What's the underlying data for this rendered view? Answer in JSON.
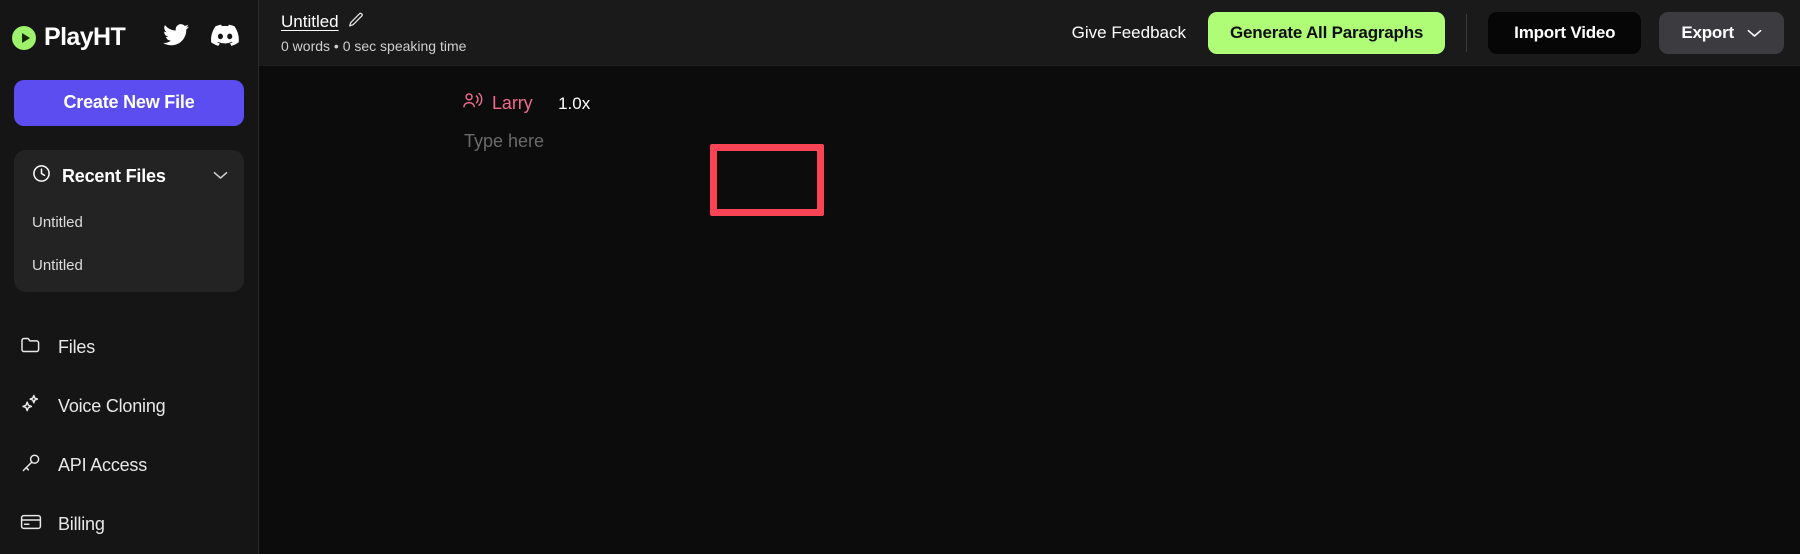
{
  "brand": {
    "name": "PlayHT",
    "logo_icon": "play-circle-icon",
    "accent_green": "#9ef16a",
    "social": [
      {
        "icon": "twitter-icon",
        "name": "Twitter"
      },
      {
        "icon": "discord-icon",
        "name": "Discord"
      }
    ]
  },
  "sidebar": {
    "create_button": "Create New File",
    "recent": {
      "icon": "clock-icon",
      "title": "Recent Files",
      "chevron": "chevron-down-icon",
      "items": [
        {
          "label": "Untitled"
        },
        {
          "label": "Untitled"
        }
      ]
    },
    "nav": [
      {
        "label": "Files",
        "icon": "folder-icon"
      },
      {
        "label": "Voice Cloning",
        "icon": "sparkles-icon"
      },
      {
        "label": "API Access",
        "icon": "key-icon"
      },
      {
        "label": "Billing",
        "icon": "credit-card-icon"
      }
    ]
  },
  "topbar": {
    "doc_title": "Untitled",
    "edit_icon": "pencil-edit-icon",
    "doc_subtitle": "0 words • 0 sec speaking time",
    "feedback_label": "Give Feedback",
    "generate_label": "Generate All Paragraphs",
    "generate_color": "#affd77",
    "import_label": "Import Video",
    "export_label": "Export",
    "export_chevron": "chevron-down-icon"
  },
  "editor": {
    "voice_icon": "speaker-voice-icon",
    "voice_name": "Larry",
    "voice_color": "#f06b8e",
    "speed": "1.0x",
    "placeholder": "Type here",
    "highlight_color": "#fb4356"
  }
}
